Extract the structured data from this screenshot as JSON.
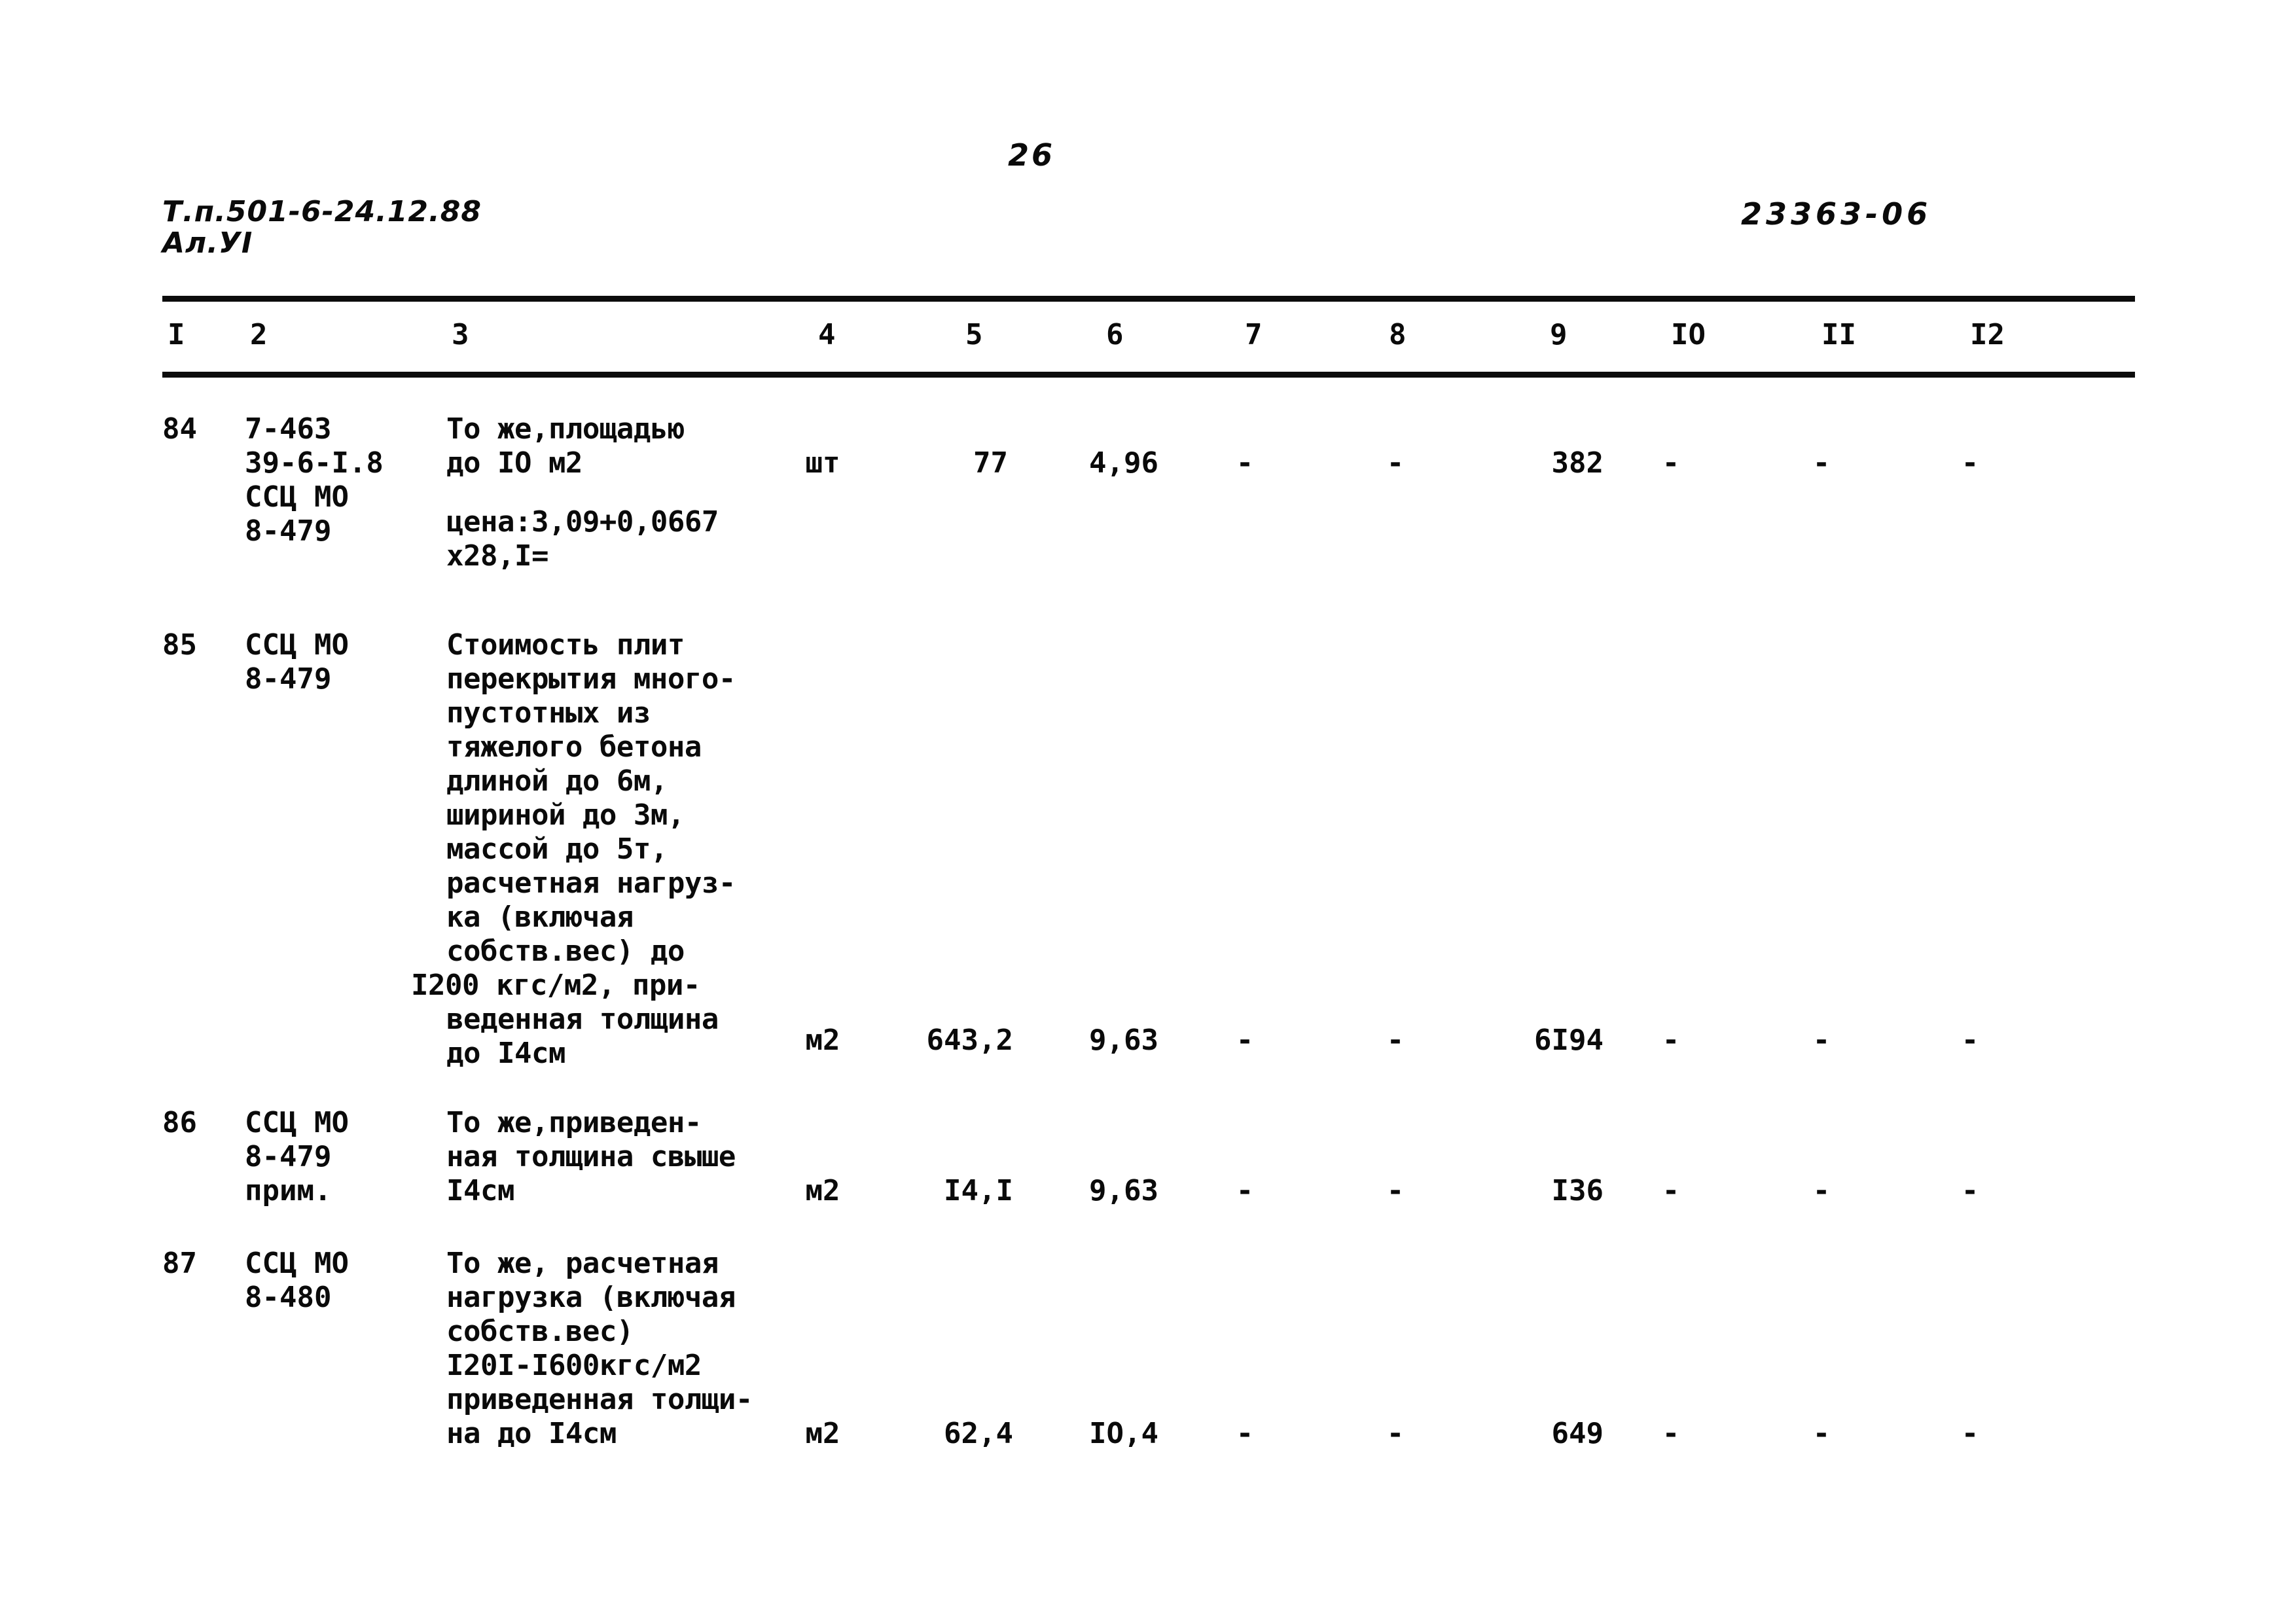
{
  "document": {
    "page_number": "26",
    "code_left_line1": "Т.п.501-6-24.12.88",
    "code_left_line2": "Ал.УI",
    "code_right": "23363-06"
  },
  "table": {
    "column_headers": [
      "I",
      "2",
      "3",
      "4",
      "5",
      "6",
      "7",
      "8",
      "9",
      "IO",
      "II",
      "I2"
    ],
    "rows": [
      {
        "c1": "84",
        "c2": "7-463\n39-6-I.8\nССЦ МО\n8-479",
        "c3_main": "То же,площадью\nдо IO м2",
        "c3_extra": "цена:3,09+0,0667\nх28,I=",
        "c4": "шт",
        "c5": "77",
        "c6": "4,96",
        "c7": "-",
        "c8": "-",
        "c9": "382",
        "c10": "-",
        "c11": "-",
        "c12": "-"
      },
      {
        "c1": "85",
        "c2": "ССЦ МО\n8-479",
        "c3_main": "Стоимость плит\nперекрытия много-\nпустотных из\nтяжелого бетона\nдлиной до 6м,\nшириной до 3м,\nмассой до 5т,\nрасчетная нагруз-\nка (включая\nсобств.вес) до",
        "c3_outdent": "I200 кгс/м2, при-",
        "c3_tail": "веденная толщина\nдо I4см",
        "c4": "м2",
        "c5": "643,2",
        "c6": "9,63",
        "c7": "-",
        "c8": "-",
        "c9": "6I94",
        "c10": "-",
        "c11": "-",
        "c12": "-"
      },
      {
        "c1": "86",
        "c2": "ССЦ МО\n8-479\nприм.",
        "c3_main": "То же,приведен-\nная толщина свыше\nI4см",
        "c4": "м2",
        "c5": "I4,I",
        "c6": "9,63",
        "c7": "-",
        "c8": "-",
        "c9": "I36",
        "c10": "-",
        "c11": "-",
        "c12": "-"
      },
      {
        "c1": "87",
        "c2": "ССЦ МО\n8-480",
        "c3_main": "То же, расчетная\nнагрузка (включая\nсобств.вес)\nI20I-I600кгс/м2\nприведенная толщи-\nна до I4см",
        "c4": "м2",
        "c5": "62,4",
        "c6": "IO,4",
        "c7": "-",
        "c8": "-",
        "c9": "649",
        "c10": "-",
        "c11": "-",
        "c12": "-"
      }
    ]
  }
}
